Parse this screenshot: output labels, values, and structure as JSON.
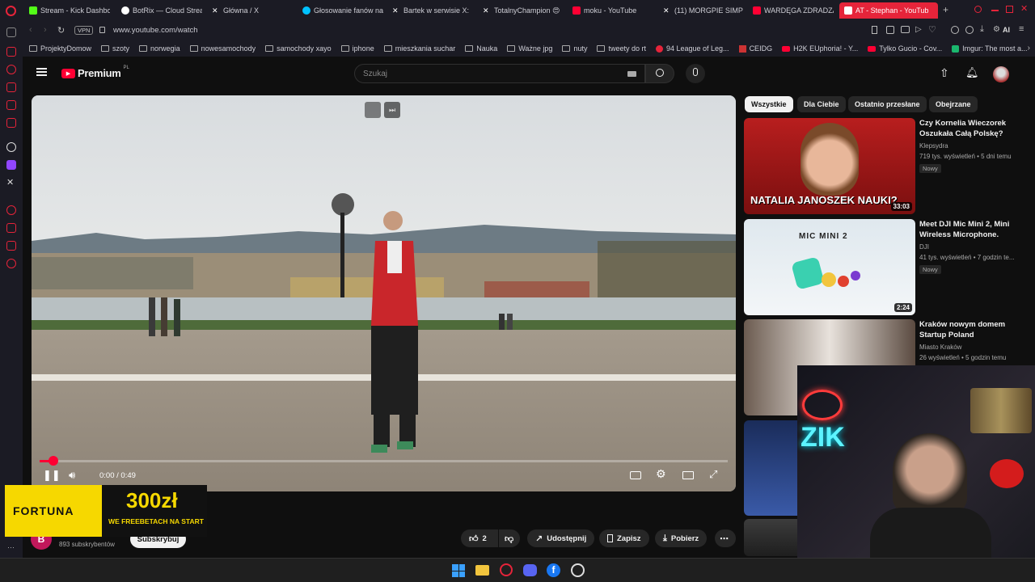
{
  "tabs": [
    {
      "label": "Stream - Kick Dashbo",
      "color": "#53fc18"
    },
    {
      "label": "BotRix — Cloud Strea",
      "color": "#ffffff"
    },
    {
      "label": "Główna / X",
      "color": "#ffffff"
    },
    {
      "label": "Głosowanie fanów na",
      "color": "#00c2ff"
    },
    {
      "label": "Bartek w serwisie X:",
      "color": "#ffffff"
    },
    {
      "label": "TotalnyChampion 😍",
      "color": "#ffffff"
    },
    {
      "label": "moku - YouTube",
      "color": "#ff0033"
    },
    {
      "label": "(11) MORGPIE SIMP w",
      "color": "#ffffff"
    },
    {
      "label": "WARDĘGA ZDRADZA",
      "color": "#ff0033"
    },
    {
      "label": "AT - Stephan - YouTub",
      "color": "#ffffff"
    }
  ],
  "address": {
    "vpn": "VPN",
    "url": "www.youtube.com/watch",
    "ai": "AI"
  },
  "bookmarks": [
    {
      "label": "ProjektyDomow"
    },
    {
      "label": "szoty"
    },
    {
      "label": "norwegia"
    },
    {
      "label": "nowesamochody"
    },
    {
      "label": "samochody xayo"
    },
    {
      "label": "iphone"
    },
    {
      "label": "mieszkania suchar"
    },
    {
      "label": "Nauka"
    },
    {
      "label": "Ważne jpg"
    },
    {
      "label": "nuty"
    },
    {
      "label": "tweety do rt"
    },
    {
      "label": "94 League of Leg..."
    },
    {
      "label": "CEIDG"
    },
    {
      "label": "H2K EUphoria! - Y..."
    },
    {
      "label": "Tylko Gucio - Cov..."
    },
    {
      "label": "Imgur: The most a..."
    }
  ],
  "yt": {
    "logo": "Premium",
    "logo_sup": "PL",
    "search_placeholder": "Szukaj",
    "brand_color": "#ff0033"
  },
  "player": {
    "time": "0:00 / 0:49",
    "progress": 0.02
  },
  "chips": [
    {
      "label": "Wszystkie"
    },
    {
      "label": "Dla Ciebie"
    },
    {
      "label": "Ostatnio przesłane"
    },
    {
      "label": "Obejrzane"
    }
  ],
  "recommendations": [
    {
      "title": "Czy Kornelia Wieczorek Oszukała Całą Polskę?",
      "channel": "Klepsydra",
      "meta": "719 tys. wyświetleń • 5 dni temu",
      "badge": "Nowy",
      "duration": "33:03",
      "thumb_text": "NATALIA JANOSZEK NAUKI?"
    },
    {
      "title": "Meet DJI Mic Mini 2, Mini Wireless Microphone.",
      "channel": "DJI",
      "meta": "41 tys. wyświetleń • 7 godzin te...",
      "badge": "Nowy",
      "duration": "2:24",
      "thumb_text": "MIC MINI 2"
    },
    {
      "title": "Kraków nowym domem Startup Poland",
      "channel": "Miasto Kraków",
      "meta": "26 wyświetleń • 5 godzin temu",
      "badge": "",
      "duration": "",
      "thumb_text": ""
    }
  ],
  "channel": {
    "initial": "B",
    "subs": "893 subskrybentów",
    "subscribe": "Subskrybuj"
  },
  "actions": {
    "likes": "2",
    "share": "Udostępnij",
    "save": "Zapisz",
    "download": "Pobierz"
  },
  "ad": {
    "brand": "FORTUNA",
    "amount": "300zł",
    "line1": "WE FREEBETACH NA START"
  },
  "overlay": {
    "neon": "ZIK"
  }
}
